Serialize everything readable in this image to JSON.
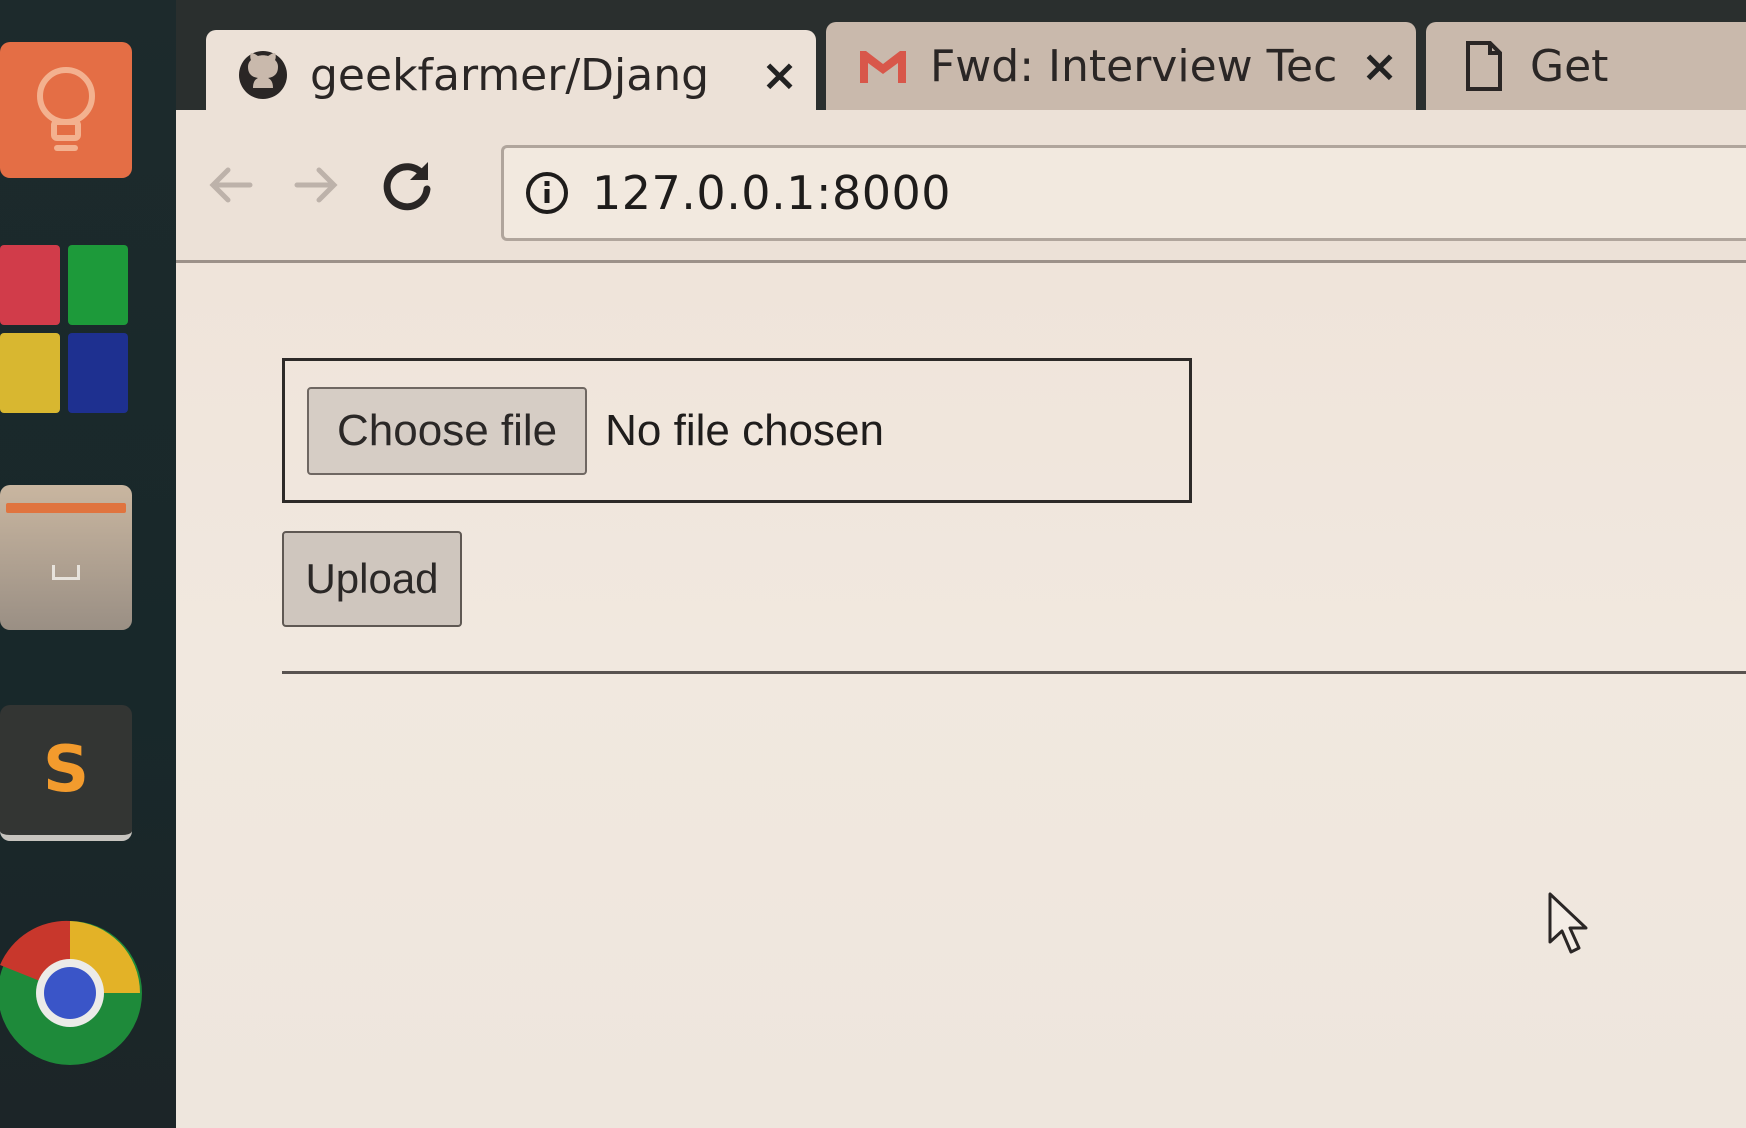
{
  "browser": {
    "tabs": [
      {
        "title": "geekfarmer/Djang",
        "icon": "github-icon",
        "active": true
      },
      {
        "title": "Fwd: Interview Tec",
        "icon": "gmail-icon",
        "active": false
      },
      {
        "title": "Get",
        "icon": "page-icon",
        "active": false
      }
    ],
    "address": "127.0.0.1:8000"
  },
  "page": {
    "file_input": {
      "button_label": "Choose file",
      "status": "No file chosen"
    },
    "upload_label": "Upload"
  },
  "colors": {
    "launcher_bulb": "#e46e45",
    "page_background": "#efe4da",
    "chrome_frame": "#ece1d7"
  }
}
